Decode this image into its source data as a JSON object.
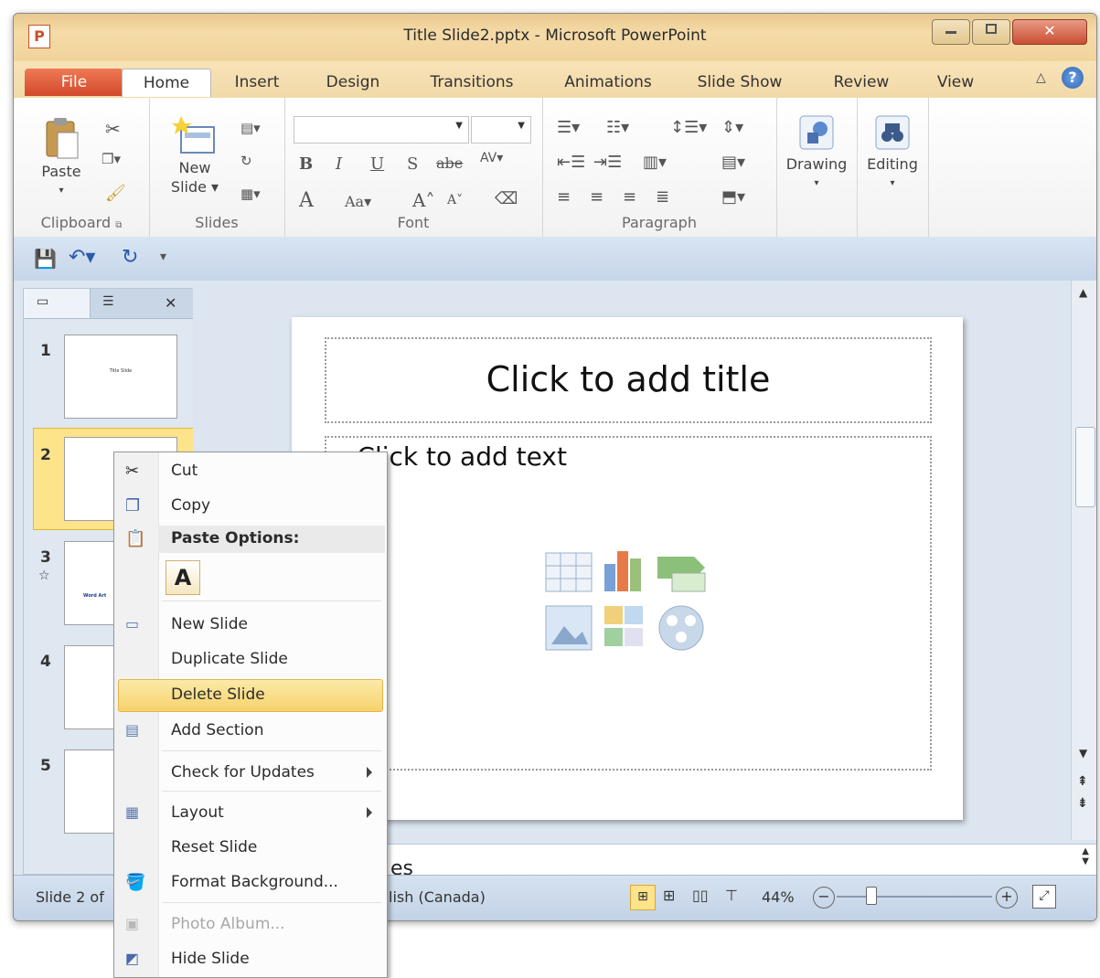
{
  "window": {
    "title": "Title Slide2.pptx  -  Microsoft PowerPoint",
    "app_icon": "P"
  },
  "tabs": {
    "file": "File",
    "items": [
      "Home",
      "Insert",
      "Design",
      "Transitions",
      "Animations",
      "Slide Show",
      "Review",
      "View"
    ]
  },
  "ribbon": {
    "clipboard": {
      "label": "Clipboard",
      "paste": "Paste"
    },
    "slides": {
      "label": "Slides",
      "new_slide_1": "New",
      "new_slide_2": "Slide"
    },
    "font": {
      "label": "Font"
    },
    "paragraph": {
      "label": "Paragraph"
    },
    "drawing": "Drawing",
    "editing": "Editing"
  },
  "slide_panel": {
    "numbers": [
      "1",
      "2",
      "3",
      "4",
      "5"
    ],
    "thumb1_text": "Title Slide",
    "thumb3_text": "Word Art"
  },
  "slide": {
    "title_placeholder": "Click to add title",
    "body_placeholder": "Click to add text",
    "bullet": "•"
  },
  "notes": {
    "partial_text": "es"
  },
  "status": {
    "slide_info": "Slide 2 of",
    "language": "lish (Canada)",
    "zoom": "44%"
  },
  "context_menu": {
    "cut": "Cut",
    "copy": "Copy",
    "paste_options": "Paste Options:",
    "paste_keep_text": "A",
    "new_slide": "New Slide",
    "duplicate_slide": "Duplicate Slide",
    "delete_slide": "Delete Slide",
    "add_section": "Add Section",
    "check_updates": "Check for Updates",
    "layout": "Layout",
    "reset_slide": "Reset Slide",
    "format_background": "Format Background...",
    "photo_album": "Photo Album...",
    "hide_slide": "Hide Slide"
  },
  "colors": {
    "accent": "#d2492a",
    "highlight": "#f7d26c",
    "ribbon_bg": "#ffffff"
  }
}
